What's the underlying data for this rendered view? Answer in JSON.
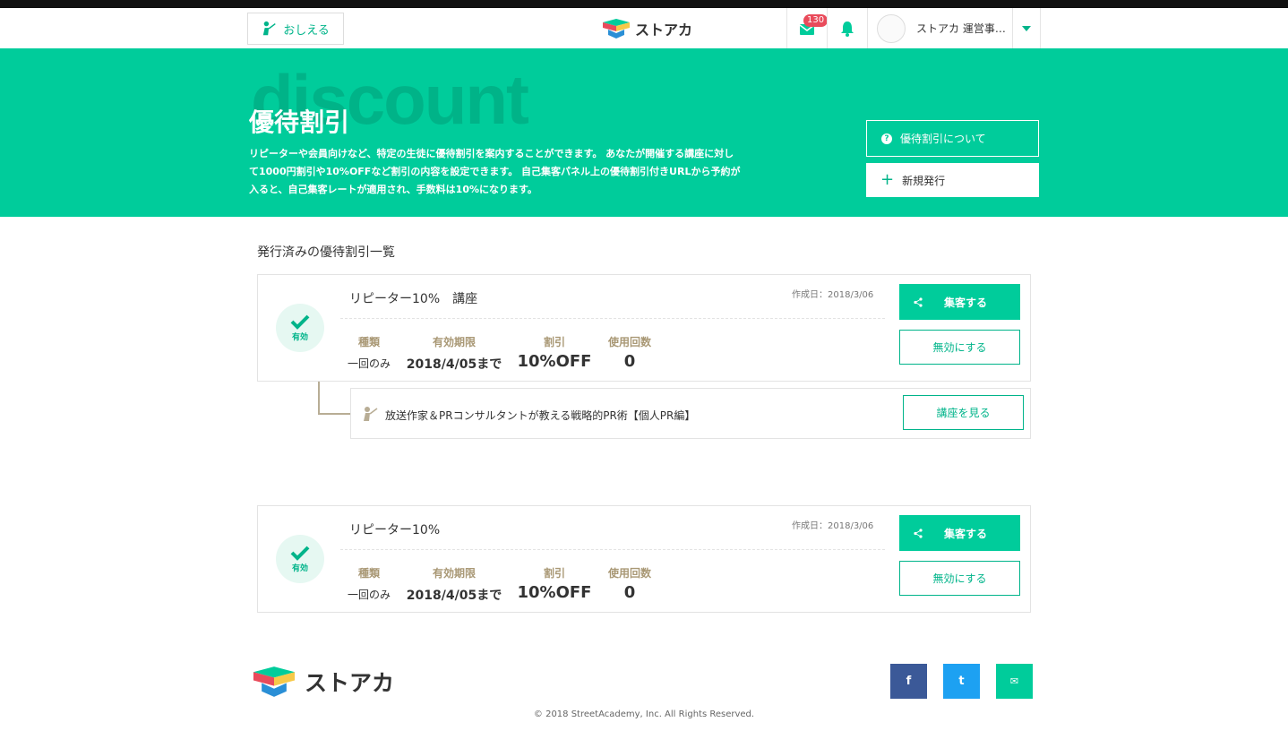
{
  "header": {
    "teach_label": "おしえる",
    "logo_text": "ストアカ",
    "mail_count": "130",
    "user_name": "ストアカ 運営事…"
  },
  "hero": {
    "bg_word": "discount",
    "title": "優待割引",
    "description": "リピーターや会員向けなど、特定の生徒に優待割引を案内することができます。 あなたが開催する講座に対して1000円割引や10%OFFなど割引の内容を設定できます。 自己集客パネル上の優待割引付きURLから予約が入ると、自己集客レートが適用され、手数料は10%になります。",
    "about_label": "優待割引について",
    "new_label": "新規発行"
  },
  "section_title": "発行済みの優待割引一覧",
  "columns": {
    "type": "種類",
    "expiry": "有効期限",
    "discount": "割引",
    "usage": "使用回数"
  },
  "coupons": [
    {
      "status": "有効",
      "name": "リピーター10%　講座",
      "created": "作成日：2018/3/06",
      "type": "一回のみ",
      "expiry": "2018/4/05まで",
      "discount": "10%OFF",
      "usage": "0",
      "promote_label": "集客する",
      "disable_label": "無効にする",
      "course": {
        "name": "放送作家＆PRコンサルタントが教える戦略的PR術【個人PR編】",
        "view_label": "講座を見る"
      }
    },
    {
      "status": "有効",
      "name": "リピーター10%",
      "created": "作成日：2018/3/06",
      "type": "一回のみ",
      "expiry": "2018/4/05まで",
      "discount": "10%OFF",
      "usage": "0",
      "promote_label": "集客する",
      "disable_label": "無効にする"
    }
  ],
  "footer": {
    "logo_text": "ストアカ",
    "facebook": "f",
    "twitter": "t",
    "email": "✉",
    "copyright": "© 2018 StreetAcademy, Inc. All Rights Reserved."
  },
  "colors": {
    "brand_green": "#00cc9b",
    "facebook": "#3b5998",
    "twitter": "#1da1f2"
  }
}
